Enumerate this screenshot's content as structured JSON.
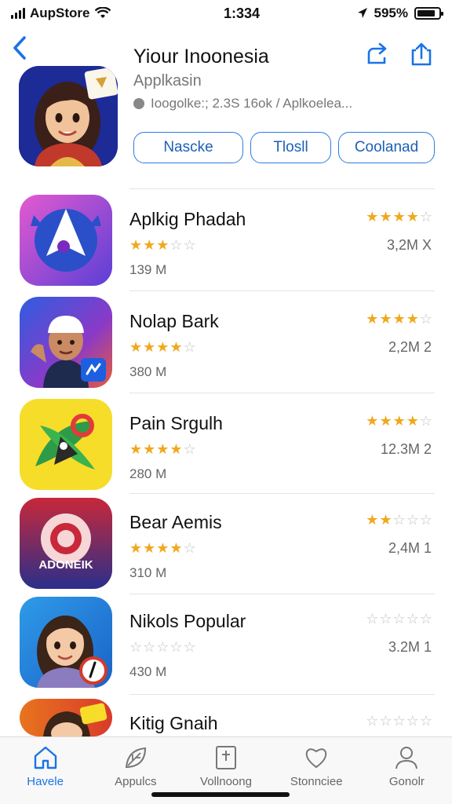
{
  "status_bar": {
    "carrier": "AupStore",
    "time": "1:334",
    "battery_percent": "595%",
    "battery_level": 0.85
  },
  "header": {
    "title": "Yiour Inoonesia",
    "subtitle": "Applkasin",
    "meta": "Ioogolke:; 2.3S 16ok / Aplkoelea...",
    "buttons": [
      "Nascke",
      "Tlosll",
      "Coolanad"
    ]
  },
  "apps": [
    {
      "name": "Aplkig Phadah",
      "rating": 3,
      "size": "139 M",
      "right_rating": 4,
      "count": "3,2M X"
    },
    {
      "name": "Nolap Bark",
      "rating": 3.5,
      "size": "380 M",
      "right_rating": 4,
      "count": "2,2M 2"
    },
    {
      "name": "Pain Srgulh",
      "rating": 3.5,
      "size": "280 M",
      "right_rating": 4,
      "count": "12.3M 2"
    },
    {
      "name": "Bear Aemis",
      "rating": 3.5,
      "size": "310 M",
      "right_rating": 2,
      "count": "2,4M 1"
    },
    {
      "name": "Nikols Popular",
      "rating": 0,
      "size": "430 M",
      "right_rating": 0,
      "count": "3.2M 1"
    },
    {
      "name": "Kitig Gnaih",
      "rating": 0,
      "size": "",
      "right_rating": 0,
      "count": ""
    }
  ],
  "icons": {
    "app_1_text": "",
    "app_4_text": "ADONEIK"
  },
  "tabs": [
    {
      "label": "Havele",
      "icon": "home-icon",
      "active": true
    },
    {
      "label": "Appulcs",
      "icon": "leaf-icon",
      "active": false
    },
    {
      "label": "Vollnoong",
      "icon": "book-icon",
      "active": false
    },
    {
      "label": "Stonnciee",
      "icon": "heart-icon",
      "active": false
    },
    {
      "label": "Gonolr",
      "icon": "profile-icon",
      "active": false
    }
  ],
  "colors": {
    "accent": "#1a73e8",
    "star": "#f0a81d",
    "star_off": "#c4c4c4"
  }
}
